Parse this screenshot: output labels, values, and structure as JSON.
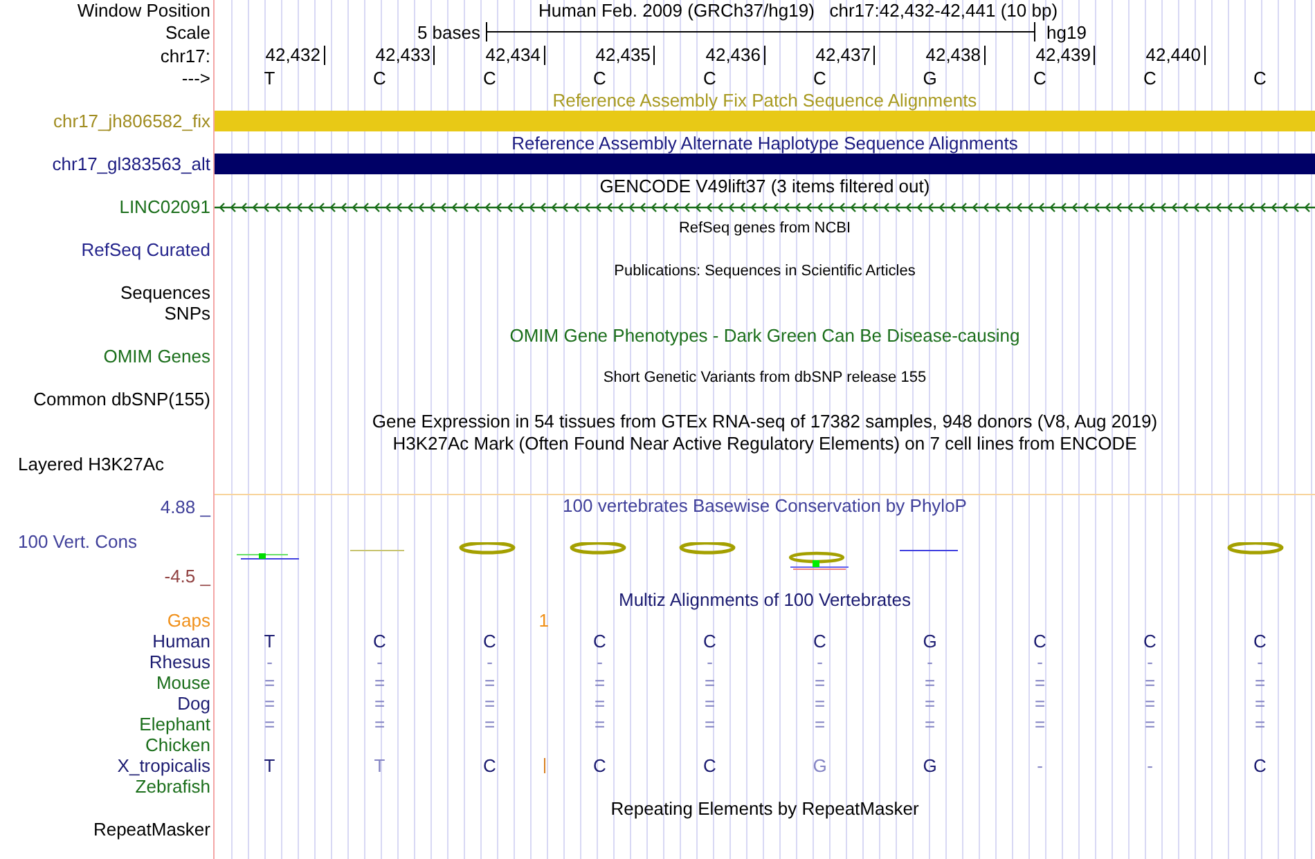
{
  "rows": [
    {
      "kind": "position",
      "label": "Window Position",
      "text": "Human Feb. 2009 (GRCh37/hg19)   chr17:42,432-42,441 (10 bp)"
    },
    {
      "kind": "scale",
      "label": "Scale",
      "span_text": "5 bases",
      "assembly": "hg19"
    },
    {
      "kind": "ruler",
      "label": "chr17:",
      "ticks": [
        "42,432",
        "42,433",
        "42,434",
        "42,435",
        "42,436",
        "42,437",
        "42,438",
        "42,439",
        "42,440"
      ]
    },
    {
      "kind": "bases",
      "label": "--->",
      "bases": [
        "T",
        "C",
        "C",
        "C",
        "C",
        "C",
        "G",
        "C",
        "C",
        "C"
      ]
    },
    {
      "kind": "title",
      "text": "Reference Assembly Fix Patch Sequence Alignments",
      "color": "#a89a20"
    },
    {
      "kind": "bar",
      "label": "chr17_jh806582_fix",
      "color": "#a08c20",
      "bar": {
        "color": "#e8c916"
      }
    },
    {
      "kind": "title",
      "text": "Reference Assembly Alternate Haplotype Sequence Alignments",
      "color": "#1a1a80"
    },
    {
      "kind": "bar",
      "label": "chr17_gl383563_alt",
      "color": "#1a1a80",
      "bar": {
        "color": "#000066"
      }
    },
    {
      "kind": "title",
      "text": "GENCODE V49lift37 (3 items filtered out)",
      "color": "#000000"
    },
    {
      "kind": "gene",
      "label": "LINC02091",
      "color": "#1a6e1a"
    },
    {
      "kind": "small-title",
      "text": "RefSeq genes from NCBI"
    },
    {
      "kind": "label",
      "label": "RefSeq Curated",
      "color": "#24248c"
    },
    {
      "kind": "small-title",
      "text": "Publications: Sequences in Scientific Articles"
    },
    {
      "kind": "label",
      "label": "Sequences",
      "color": "#000000"
    },
    {
      "kind": "label",
      "label": "SNPs",
      "color": "#000000"
    },
    {
      "kind": "title",
      "text": "OMIM Gene Phenotypes - Dark Green Can Be Disease-causing",
      "color": "#1a6e1a"
    },
    {
      "kind": "label",
      "label": "OMIM Genes",
      "color": "#1a6e1a"
    },
    {
      "kind": "small-title",
      "text": "Short Genetic Variants from dbSNP release 155"
    },
    {
      "kind": "label",
      "label": "Common dbSNP(155)",
      "color": "#000000"
    },
    {
      "kind": "title",
      "text": "Gene Expression in 54 tissues from GTEx RNA-seq of 17382 samples, 948 donors (V8, Aug 2019)",
      "color": "#000000"
    },
    {
      "kind": "title",
      "text": "H3K27Ac Mark (Often Found Near Active Regulatory Elements) on 7 cell lines from ENCODE",
      "color": "#000000"
    },
    {
      "kind": "composite",
      "label": "Layered H3K27Ac",
      "color": "#000000"
    },
    {
      "kind": "wiggle",
      "label": "100 Vert. Cons",
      "max": {
        "text": "4.88 _",
        "color": "#40409a"
      },
      "min": {
        "text": "-4.5 _",
        "color": "#904040"
      },
      "title": "100 vertebrates Basewise Conservation by PhyloP",
      "color": "#40409a"
    },
    {
      "kind": "title",
      "text": "Multiz Alignments of 100 Vertebrates",
      "color": "#1a1a70"
    },
    {
      "kind": "gaps",
      "label": "Gaps",
      "color": "#f0901a",
      "cells": [
        {},
        {},
        {
          "count": "1"
        },
        {},
        {},
        {},
        {},
        {},
        {},
        {}
      ]
    },
    {
      "kind": "species",
      "label": "Human",
      "color": "#1a1a70",
      "bases": [
        {
          "b": "T",
          "faint": false
        },
        {
          "b": "C",
          "faint": false
        },
        {
          "b": "C",
          "faint": false
        },
        {
          "b": "C",
          "faint": false
        },
        {
          "b": "C",
          "faint": false
        },
        {
          "b": "C",
          "faint": false
        },
        {
          "b": "G",
          "faint": false
        },
        {
          "b": "C",
          "faint": false
        },
        {
          "b": "C",
          "faint": false
        },
        {
          "b": "C",
          "faint": false
        }
      ]
    },
    {
      "kind": "species",
      "label": "Rhesus",
      "color": "#1a1a70",
      "bases": [
        {
          "b": "-",
          "faint": true
        },
        {
          "b": "-",
          "faint": true
        },
        {
          "b": "-",
          "faint": true
        },
        {
          "b": "-",
          "faint": true
        },
        {
          "b": "-",
          "faint": true
        },
        {
          "b": "-",
          "faint": true
        },
        {
          "b": "-",
          "faint": true
        },
        {
          "b": "-",
          "faint": true
        },
        {
          "b": "-",
          "faint": true
        },
        {
          "b": "-",
          "faint": true
        }
      ]
    },
    {
      "kind": "species",
      "label": "Mouse",
      "color": "#1a6e1a",
      "bases": [
        {
          "b": "=",
          "faint": true
        },
        {
          "b": "=",
          "faint": true
        },
        {
          "b": "=",
          "faint": true
        },
        {
          "b": "=",
          "faint": true
        },
        {
          "b": "=",
          "faint": true
        },
        {
          "b": "=",
          "faint": true
        },
        {
          "b": "=",
          "faint": true
        },
        {
          "b": "=",
          "faint": true
        },
        {
          "b": "=",
          "faint": true
        },
        {
          "b": "=",
          "faint": true
        }
      ]
    },
    {
      "kind": "species",
      "label": "Dog",
      "color": "#1a1a70",
      "bases": [
        {
          "b": "=",
          "faint": true
        },
        {
          "b": "=",
          "faint": true
        },
        {
          "b": "=",
          "faint": true
        },
        {
          "b": "=",
          "faint": true
        },
        {
          "b": "=",
          "faint": true
        },
        {
          "b": "=",
          "faint": true
        },
        {
          "b": "=",
          "faint": true
        },
        {
          "b": "=",
          "faint": true
        },
        {
          "b": "=",
          "faint": true
        },
        {
          "b": "=",
          "faint": true
        }
      ]
    },
    {
      "kind": "species",
      "label": "Elephant",
      "color": "#1a6e1a",
      "bases": [
        {
          "b": "=",
          "faint": true
        },
        {
          "b": "=",
          "faint": true
        },
        {
          "b": "=",
          "faint": true
        },
        {
          "b": "=",
          "faint": true
        },
        {
          "b": "=",
          "faint": true
        },
        {
          "b": "=",
          "faint": true
        },
        {
          "b": "=",
          "faint": true
        },
        {
          "b": "=",
          "faint": true
        },
        {
          "b": "=",
          "faint": true
        },
        {
          "b": "=",
          "faint": true
        }
      ]
    },
    {
      "kind": "species",
      "label": "Chicken",
      "color": "#1a6e1a"
    },
    {
      "kind": "species",
      "label": "X_tropicalis",
      "color": "#1a1a70",
      "bases": [
        {
          "b": "T",
          "faint": false
        },
        {
          "b": "T",
          "faint": true
        },
        {
          "b": "C",
          "faint": false,
          "insertion": true
        },
        {
          "b": "C",
          "faint": false
        },
        {
          "b": "C",
          "faint": false
        },
        {
          "b": "G",
          "faint": true
        },
        {
          "b": "G",
          "faint": false
        },
        {
          "b": "-",
          "faint": true
        },
        {
          "b": "-",
          "faint": true
        },
        {
          "b": "C",
          "faint": false
        }
      ]
    },
    {
      "kind": "species",
      "label": "Zebrafish",
      "color": "#1a6e1a"
    },
    {
      "kind": "title",
      "text": "Repeating Elements by RepeatMasker",
      "color": "#000000"
    },
    {
      "kind": "label",
      "label": "RepeatMasker",
      "color": "#000000"
    }
  ]
}
